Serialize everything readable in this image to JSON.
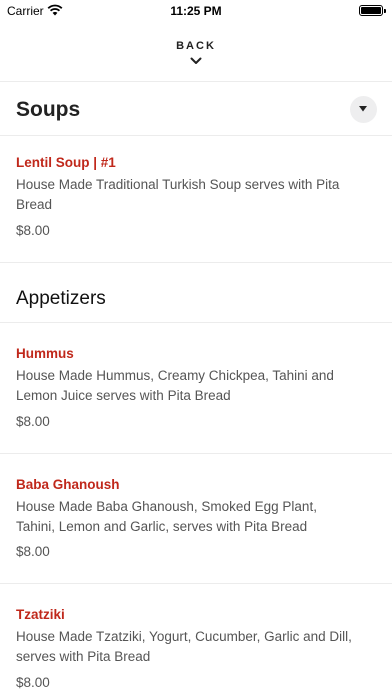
{
  "status_bar": {
    "carrier": "Carrier",
    "time": "11:25 PM",
    "battery_level": 1.0
  },
  "back_button": {
    "label": "BACK",
    "icon": "chevron-down-icon"
  },
  "sections": [
    {
      "title": "Soups",
      "items": [
        {
          "name": "Lentil Soup | #1",
          "description": "House Made Traditional Turkish Soup serves with Pita Bread",
          "price": "$8.00"
        }
      ]
    },
    {
      "title": "Appetizers",
      "items": [
        {
          "name": "Hummus",
          "description": "House Made Hummus, Creamy Chickpea, Tahini and Lemon Juice serves with Pita Bread",
          "price": "$8.00"
        },
        {
          "name": "Baba Ghanoush",
          "description": "House Made Baba Ghanoush, Smoked Egg Plant, Tahini, Lemon and Garlic, serves with Pita Bread",
          "price": "$8.00"
        },
        {
          "name": "Tzatziki",
          "description": "House Made Tzatziki, Yogurt, Cucumber, Garlic and Dill, serves with Pita Bread",
          "price": "$8.00"
        }
      ]
    }
  ],
  "colors": {
    "item_name": "#c0281b",
    "divider": "#ececec",
    "dropdown_bg": "#eeeeef"
  }
}
